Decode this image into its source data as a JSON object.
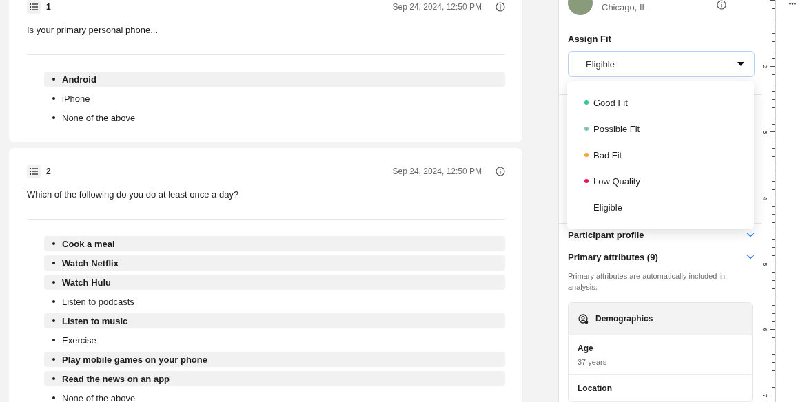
{
  "questions": [
    {
      "number": "1",
      "timestamp": "Sep 24, 2024, 12:50 PM",
      "text": "Is your primary personal phone...",
      "answers": [
        {
          "label": "Android",
          "selected": true
        },
        {
          "label": "iPhone",
          "selected": false
        },
        {
          "label": "None of the above",
          "selected": false
        }
      ]
    },
    {
      "number": "2",
      "timestamp": "Sep 24, 2024, 12:50 PM",
      "text": "Which of the following do you do at least once a day?",
      "answers": [
        {
          "label": "Cook a meal",
          "selected": true
        },
        {
          "label": "Watch Netflix",
          "selected": true
        },
        {
          "label": "Watch Hulu",
          "selected": true
        },
        {
          "label": "Listen to podcasts",
          "selected": false
        },
        {
          "label": "Listen to music",
          "selected": true
        },
        {
          "label": "Exercise",
          "selected": false
        },
        {
          "label": "Play mobile games on your phone",
          "selected": true
        },
        {
          "label": "Read the news on an app",
          "selected": true
        },
        {
          "label": "None of the above",
          "selected": false
        }
      ]
    }
  ],
  "participant": {
    "location": "Chicago, IL"
  },
  "assign_fit": {
    "label": "Assign Fit",
    "value": "Eligible",
    "expanded": true,
    "options": [
      {
        "label": "Good Fit",
        "color": "#2fc98b"
      },
      {
        "label": "Possible Fit",
        "color": "#7fc3bd"
      },
      {
        "label": "Bad Fit",
        "color": "#f4a62a"
      },
      {
        "label": "Low Quality",
        "color": "#e3174d"
      },
      {
        "label": "Eligible"
      }
    ]
  },
  "sections": [
    {
      "title": "Participant profile",
      "expanded": false
    },
    {
      "title": "Primary attributes (9)",
      "expanded": false
    }
  ],
  "primary_attributes_note": "Primary attributes are automatically included in analysis.",
  "demographics": {
    "title": "Demographics",
    "fields": [
      {
        "label": "Age",
        "value": "37 years"
      },
      {
        "label": "Location"
      }
    ]
  },
  "ruler": {
    "labels": [
      "2",
      "3",
      "4",
      "5",
      "6",
      "7"
    ]
  }
}
